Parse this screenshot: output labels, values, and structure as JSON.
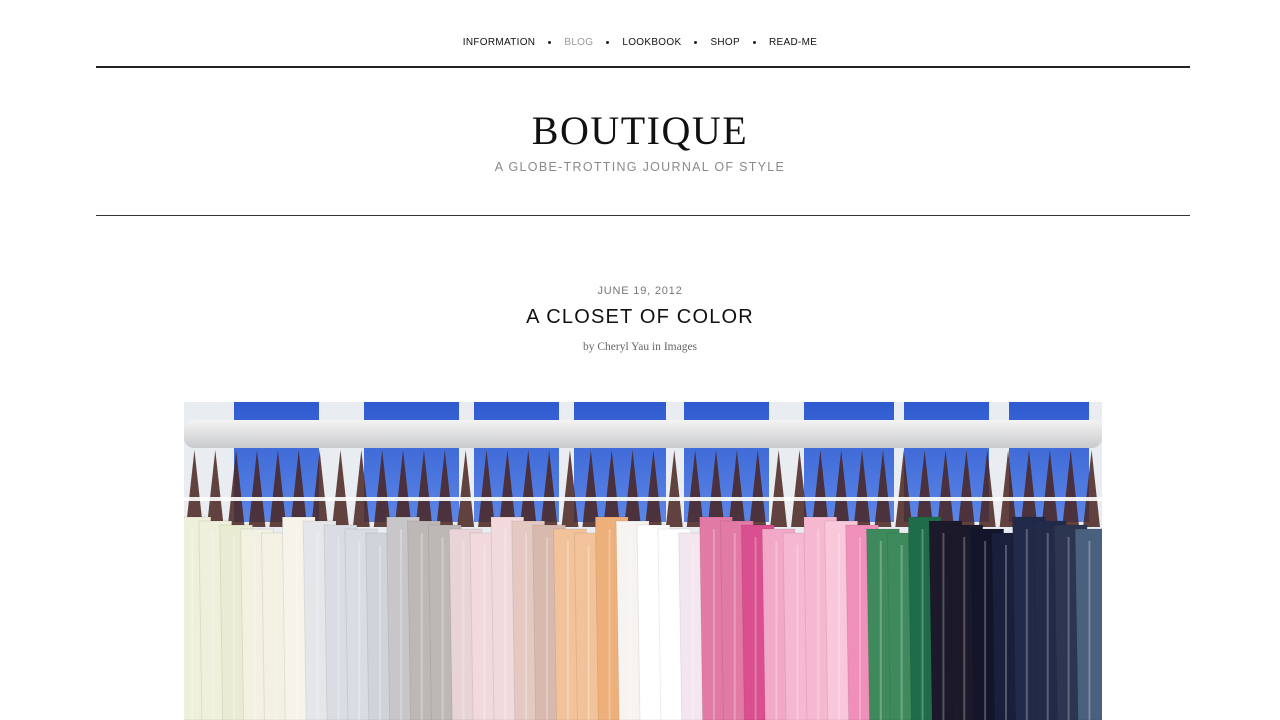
{
  "nav": {
    "items": [
      {
        "label": "INFORMATION",
        "active": false
      },
      {
        "label": "BLOG",
        "active": true
      },
      {
        "label": "LOOKBOOK",
        "active": false
      },
      {
        "label": "SHOP",
        "active": false
      },
      {
        "label": "READ-ME",
        "active": false
      }
    ]
  },
  "site": {
    "title": "BOUTIQUE",
    "tagline": "A GLOBE-TROTTING JOURNAL OF STYLE"
  },
  "post": {
    "date": "JUNE 19, 2012",
    "title": "A CLOSET OF COLOR",
    "byline_prefix": "by",
    "author": "Cheryl Yau",
    "byline_middle": "in",
    "category": "Images"
  },
  "colors": {
    "nav_active": "#999999",
    "rule": "#222222",
    "window_blue": "#3a66d6",
    "hanger": "#4a2520"
  }
}
